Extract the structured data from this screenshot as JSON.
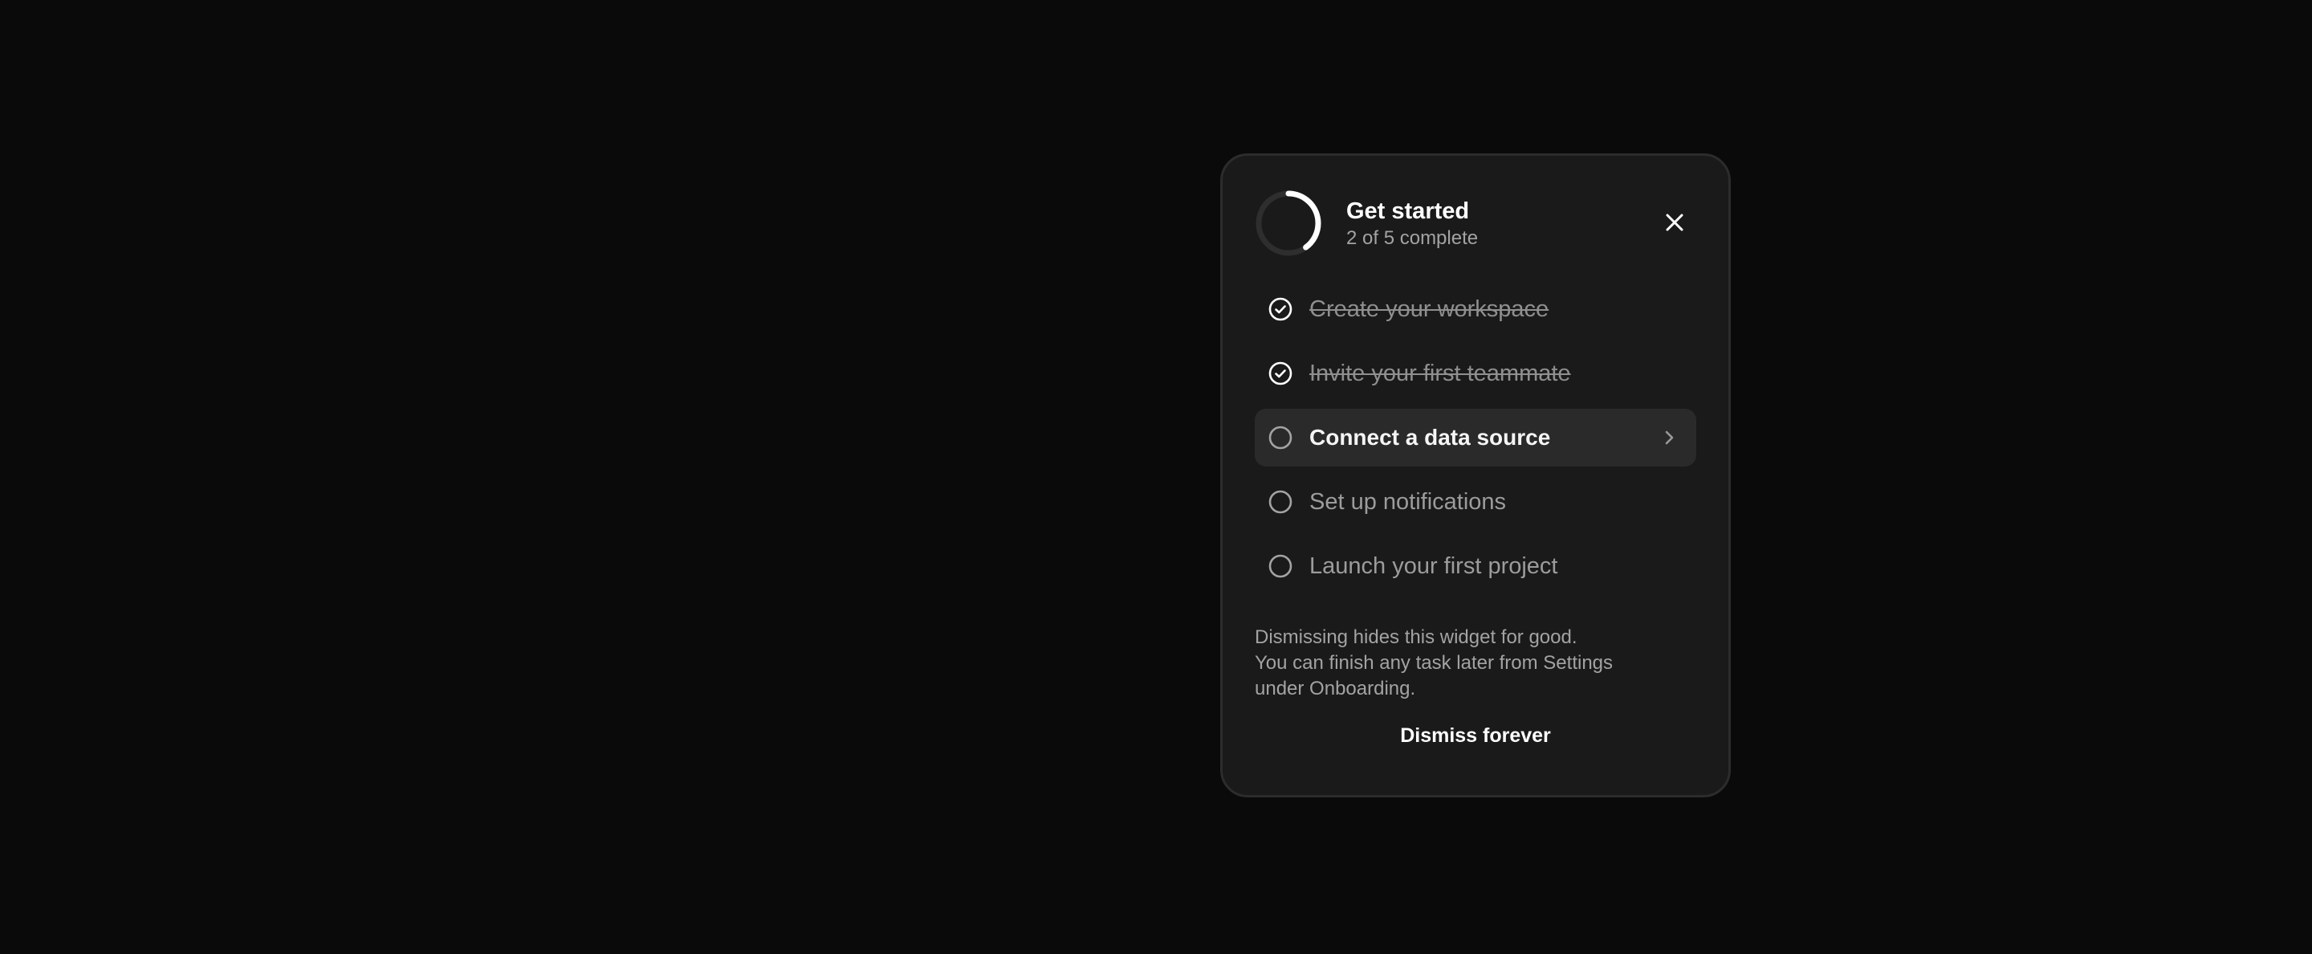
{
  "widget": {
    "title": "Get started",
    "progress_text": "2 of 5 complete",
    "progress": {
      "completed": 2,
      "total": 5
    },
    "close_icon": "close-icon"
  },
  "tasks": [
    {
      "label": "Create your workspace",
      "status": "done",
      "icon": "check-circle-icon"
    },
    {
      "label": "Invite your first teammate",
      "status": "done",
      "icon": "check-circle-icon"
    },
    {
      "label": "Connect a data source",
      "status": "current",
      "icon": "circle-icon",
      "trailing_icon": "chevron-right-icon"
    },
    {
      "label": "Set up notifications",
      "status": "todo",
      "icon": "circle-icon"
    },
    {
      "label": "Launch your first project",
      "status": "todo",
      "icon": "circle-icon"
    }
  ],
  "footer": {
    "note_lines": [
      "Dismissing hides this widget for good.",
      "You can finish any task later from Settings",
      "under Onboarding."
    ],
    "dismiss_label": "Dismiss forever"
  },
  "colors": {
    "background": "#0a0a0a",
    "card": "#1a1a1a",
    "card_border": "#2c2c2c",
    "active_row": "#2a2a2a",
    "text_primary": "#ffffff",
    "text_muted": "#a3a3a3",
    "ring_track": "#2e2e2e",
    "ring_fill": "#ffffff"
  }
}
